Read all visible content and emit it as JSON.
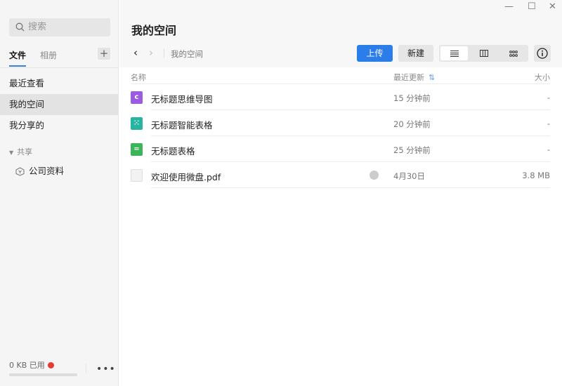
{
  "sidebar": {
    "search_placeholder": "搜索",
    "tabs": [
      {
        "label": "文件"
      },
      {
        "label": "相册"
      }
    ],
    "add_label": "+",
    "items": [
      {
        "label": "最近查看"
      },
      {
        "label": "我的空间"
      },
      {
        "label": "我分享的"
      }
    ],
    "shared_section": "共享",
    "shared_folders": [
      {
        "label": "公司资料"
      }
    ],
    "usage": "0 KB 已用",
    "more": "•••",
    "storage_used_fraction": 0
  },
  "window": {
    "minimize": "—",
    "maximize": "☐",
    "close": "✕"
  },
  "header": {
    "title": "我的空间",
    "back": "‹",
    "forward": "›",
    "breadcrumb": "我的空间",
    "upload": "上传",
    "new": "新建"
  },
  "table": {
    "columns": {
      "name": "名称",
      "updated": "最近更新",
      "size": "大小"
    },
    "rows": [
      {
        "name": "无标题思维导图",
        "updated": "15 分钟前",
        "size": "-",
        "type": "mindmap",
        "color": "#9c5ce0"
      },
      {
        "name": "无标题智能表格",
        "updated": "20 分钟前",
        "size": "-",
        "type": "smartsheet",
        "color": "#26b5a0"
      },
      {
        "name": "无标题表格",
        "updated": "25 分钟前",
        "size": "-",
        "type": "sheet",
        "color": "#3cb55a"
      },
      {
        "name": "欢迎使用微盘.pdf",
        "updated": "4月30日",
        "size": "3.8 MB",
        "type": "pdf",
        "color": "#f2f2f2"
      }
    ]
  }
}
